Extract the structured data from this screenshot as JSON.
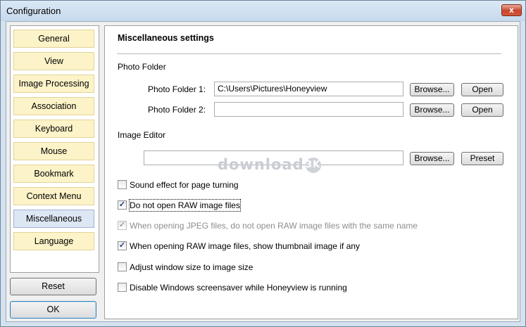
{
  "window": {
    "title": "Configuration",
    "close_glyph": "x"
  },
  "nav": {
    "items": [
      {
        "label": "General"
      },
      {
        "label": "View"
      },
      {
        "label": "Image Processing"
      },
      {
        "label": "Association"
      },
      {
        "label": "Keyboard"
      },
      {
        "label": "Mouse"
      },
      {
        "label": "Bookmark"
      },
      {
        "label": "Context Menu"
      },
      {
        "label": "Miscellaneous",
        "selected": true
      },
      {
        "label": "Language"
      }
    ],
    "reset_label": "Reset",
    "ok_label": "OK"
  },
  "content": {
    "section_title": "Miscellaneous settings",
    "photo_folder": {
      "group_label": "Photo Folder",
      "folder1_label": "Photo Folder 1:",
      "folder1_value": "C:\\Users\\Pictures\\Honeyview",
      "folder2_label": "Photo Folder 2:",
      "folder2_value": "",
      "browse_label": "Browse...",
      "open_label": "Open"
    },
    "image_editor": {
      "group_label": "Image Editor",
      "value": "",
      "browse_label": "Browse...",
      "preset_label": "Preset"
    },
    "options": [
      {
        "label": "Sound effect for page turning",
        "checked": false,
        "disabled": false
      },
      {
        "label": "Do not open RAW image files",
        "checked": true,
        "disabled": false
      },
      {
        "label": "When opening JPEG files, do not open RAW image files with the same name",
        "checked": true,
        "disabled": true
      },
      {
        "label": "When opening RAW image files, show thumbnail image if any",
        "checked": true,
        "disabled": false
      },
      {
        "label": "Adjust window size to image size",
        "checked": false,
        "disabled": false
      },
      {
        "label": "Disable Windows screensaver while Honeyview is running",
        "checked": false,
        "disabled": false
      }
    ],
    "check_glyph": "✓",
    "watermark_text": "download",
    "watermark_badge": "3K"
  },
  "colors": {
    "nav_item_bg": "#fdf3c8",
    "nav_item_selected_bg": "#dde6f3",
    "close_button": "#c9462c"
  }
}
